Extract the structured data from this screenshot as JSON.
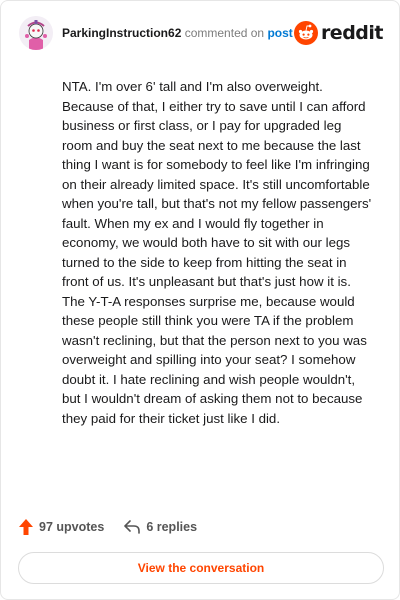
{
  "header": {
    "username": "ParkingInstruction62",
    "commented_text": "commented on",
    "post_link": "post",
    "brand_text": "reddit"
  },
  "comment": {
    "body": "NTA. I'm over 6' tall and I'm also overweight. Because of that, I either try to save until I can afford business or first class, or I pay for upgraded leg room and buy the seat next to me because the last thing I want is for somebody to feel like I'm infringing on their already limited space. It's still uncomfortable when you're tall, but that's not my fellow passengers' fault. When my ex and I would fly together in economy, we would both have to sit with our legs turned to the side to keep from hitting the seat in front of us. It's unpleasant but that's just how it is. The Y-T-A responses surprise me, because would these people still think you were TA if the problem wasn't reclining, but that the person next to you was overweight and spilling into your seat? I somehow doubt it. I hate reclining and wish people wouldn't, but I wouldn't dream of asking them not to because they paid for their ticket just like I did."
  },
  "footer": {
    "upvotes": "97 upvotes",
    "replies": "6 replies",
    "cta": "View the conversation"
  },
  "colors": {
    "accent": "#ff4500",
    "link": "#0079d3",
    "text": "#1a1a1b"
  },
  "icons": [
    "avatar",
    "reddit-logo-icon",
    "upvote-arrow-icon",
    "reply-arrow-icon"
  ]
}
